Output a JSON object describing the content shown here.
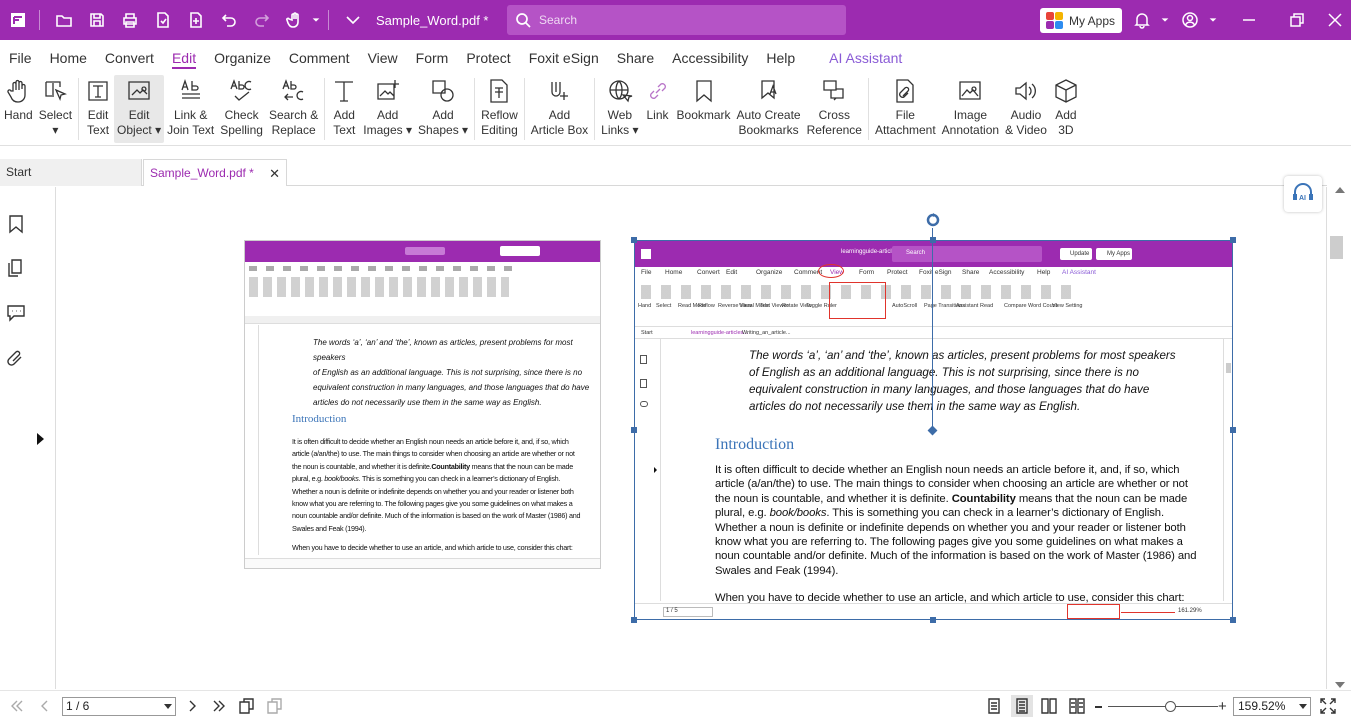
{
  "titlebar": {
    "doc_title": "Sample_Word.pdf *",
    "search_placeholder": "Search",
    "my_apps": "My Apps",
    "brand_color": "#9c2bb0"
  },
  "menu": [
    "File",
    "Home",
    "Convert",
    "Edit",
    "Organize",
    "Comment",
    "View",
    "Form",
    "Protect",
    "Foxit eSign",
    "Share",
    "Accessibility",
    "Help"
  ],
  "menu_active": "Edit",
  "menu_ai": "AI Assistant",
  "ribbon": [
    {
      "label": "Hand",
      "icon": "hand-icon"
    },
    {
      "label": "Select\n▾",
      "icon": "select-icon"
    },
    {
      "label": "Edit\nText",
      "icon": "edit-text-icon"
    },
    {
      "label": "Edit\nObject ▾",
      "icon": "edit-object-icon"
    },
    {
      "label": "Link &\nJoin Text",
      "icon": "link-join-text-icon"
    },
    {
      "label": "Check\nSpelling",
      "icon": "check-spelling-icon"
    },
    {
      "label": "Search &\nReplace",
      "icon": "search-replace-icon"
    },
    {
      "label": "Add\nText",
      "icon": "add-text-icon"
    },
    {
      "label": "Add\nImages ▾",
      "icon": "add-images-icon"
    },
    {
      "label": "Add\nShapes ▾",
      "icon": "add-shapes-icon"
    },
    {
      "label": "Reflow\nEditing",
      "icon": "reflow-editing-icon"
    },
    {
      "label": "Add\nArticle Box",
      "icon": "add-article-box-icon"
    },
    {
      "label": "Web\nLinks ▾",
      "icon": "web-links-icon"
    },
    {
      "label": "Link",
      "icon": "link-icon"
    },
    {
      "label": "Bookmark",
      "icon": "bookmark-icon"
    },
    {
      "label": "Auto Create\nBookmarks",
      "icon": "auto-bookmarks-icon"
    },
    {
      "label": "Cross\nReference",
      "icon": "cross-reference-icon"
    },
    {
      "label": "File\nAttachment",
      "icon": "file-attachment-icon"
    },
    {
      "label": "Image\nAnnotation",
      "icon": "image-annotation-icon"
    },
    {
      "label": "Audio\n& Video",
      "icon": "audio-video-icon"
    },
    {
      "label": "Add\n3D",
      "icon": "add-3d-icon"
    }
  ],
  "tabs": {
    "start": "Start",
    "doc": "Sample_Word.pdf *"
  },
  "embedded": {
    "url": "learningguide-articlesandlistgrammar.pdf",
    "search": "Search",
    "update": "Update",
    "my_apps": "My Apps",
    "menu": [
      "File",
      "Home",
      "Convert",
      "Edit",
      "Organize",
      "Comment",
      "View",
      "Form",
      "Protect",
      "Foxit eSign",
      "Share",
      "Accessibility",
      "Help",
      "AI Assistant"
    ],
    "ribbon": [
      "Hand",
      "Select",
      "Read Mode",
      "Reflow",
      "Reverse View",
      "Visual Mode",
      "Text Viewer",
      "Rotate View",
      "Toggle Ruler",
      "AutoScroll",
      "Page Transitions",
      "Assistant",
      "Read",
      "Compare",
      "Word Count",
      "View Setting"
    ],
    "tabs": [
      "Start",
      "learningguide-articles...",
      "Writing_an_article..."
    ],
    "page": "1 / 5",
    "zoom": "161.29%",
    "italic_lines": [
      "The words ‘a’, ‘an’ and ‘the’, known as articles, present problems for most speakers",
      "of English as an additional language. This is not surprising, since there is no",
      "equivalent construction in many languages, and those languages that do have",
      "articles do not necessarily use them in the same way as English."
    ],
    "heading": "Introduction",
    "body_lines": [
      "It is often difficult to decide whether an English noun needs an article before it, and, if so, which",
      "article (a/an/the) to use. The main things to consider when choosing an article are whether or not",
      "the noun is countable, and whether it is definite.",
      "Countability",
      " means that the noun can be made",
      "plural, e.g. ",
      "book/books",
      ". This is something you can check in a learner’s dictionary of English.",
      "Whether a noun is definite or indefinite depends on whether you and your reader or listener both",
      "know what you are referring to. The following pages give you some guidelines on what makes a",
      "noun countable and/or definite. Much of the information is based on the work of Master (1986) and",
      "Swales and Feak (1994)."
    ],
    "last_line": "When you have to decide whether to use an article, and which article to use, consider this chart:"
  },
  "status": {
    "page": "1 / 6",
    "zoom": "159.52%"
  }
}
